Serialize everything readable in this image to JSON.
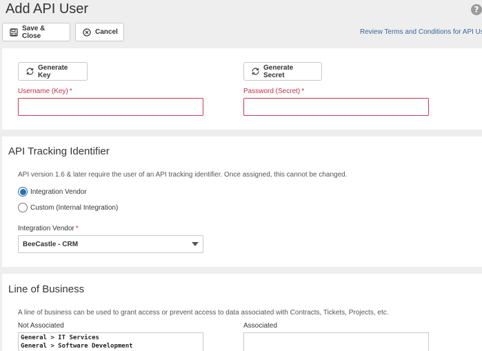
{
  "header": {
    "title": "Add API User",
    "help_glyph": "?"
  },
  "toolbar": {
    "save_label": "Save & Close",
    "cancel_label": "Cancel",
    "terms_link": "Review Terms and Conditions for API Us"
  },
  "credentials": {
    "generate_key_label": "Generate Key",
    "generate_secret_label": "Generate Secret",
    "username_label": "Username (Key)",
    "password_label": "Password (Secret)",
    "required_marker": "*",
    "username_value": "",
    "password_value": ""
  },
  "tracking": {
    "title": "API Tracking Identifier",
    "description": "API version 1.6 & later require the user of an API tracking identifier. Once assigned, this cannot be changed.",
    "options": [
      {
        "label": "Integration Vendor",
        "checked": true
      },
      {
        "label": "Custom (Internal Integration)",
        "checked": false
      }
    ],
    "vendor_label": "Integration Vendor",
    "vendor_selected": "BeeCastle - CRM"
  },
  "line_of_business": {
    "title": "Line of Business",
    "description": "A line of business can be used to grant access or prevent access to data associated with Contracts, Tickets, Projects, etc.",
    "not_associated_label": "Not Associated",
    "associated_label": "Associated",
    "not_associated_items": [
      "General > IT Services",
      "General > Software Development"
    ],
    "associated_items": []
  },
  "colors": {
    "accent": "#2a6fb0",
    "required": "#c0304a",
    "link": "#376597"
  }
}
